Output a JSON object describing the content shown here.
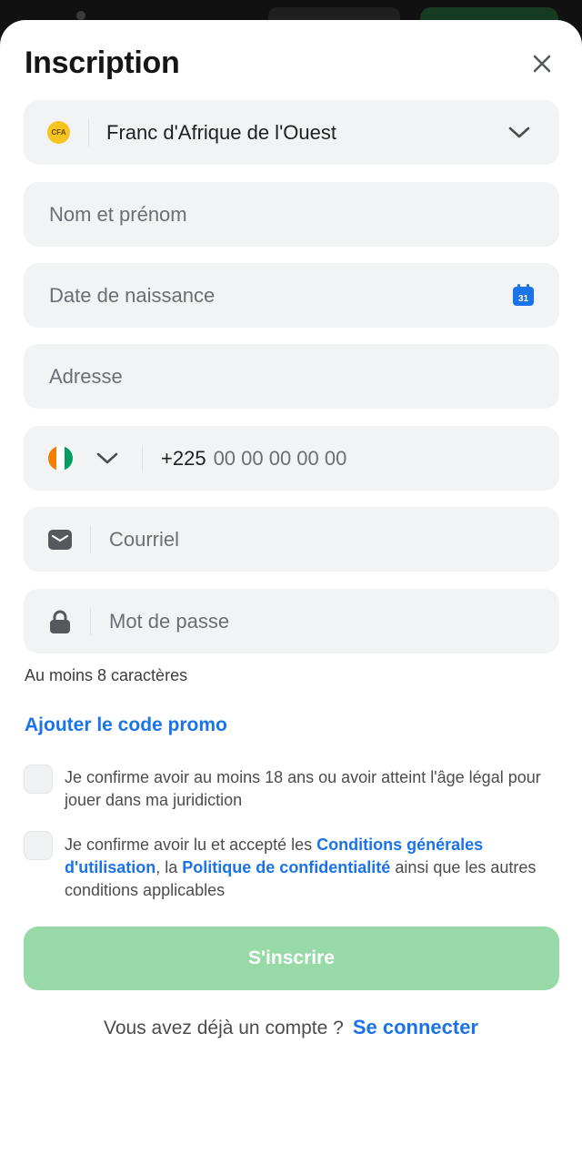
{
  "form": {
    "title": "Inscription",
    "currency": {
      "badge": "CFA",
      "label": "Franc d'Afrique de l'Ouest"
    },
    "name_placeholder": "Nom et prénom",
    "birthdate_placeholder": "Date de naissance",
    "calendar_day": "31",
    "address_placeholder": "Adresse",
    "phone": {
      "prefix": "+225",
      "placeholder": "00 00 00 00 00",
      "flag_colors": [
        "#f77f00",
        "#ffffff",
        "#009e60"
      ]
    },
    "email_placeholder": "Courriel",
    "password_placeholder": "Mot de passe",
    "password_hint": "Au moins 8 caractères",
    "promo_link": "Ajouter le code promo",
    "age_consent": "Je confirme avoir au moins 18 ans ou avoir atteint l'âge légal pour jouer dans ma juridiction",
    "terms_consent": {
      "part1": "Je confirme avoir lu et accepté les ",
      "link1": "Conditions générales d'utilisation",
      "part2": ", la ",
      "link2": "Politique de confidentialité",
      "part3": " ainsi que les autres conditions applicables"
    },
    "submit_label": "S'inscrire",
    "login_prompt": "Vous avez déjà un compte ?",
    "login_link": "Se connecter"
  },
  "colors": {
    "accent": "#1a73e8",
    "submit_disabled": "#98d9a8",
    "field_bg": "#f2f3f5"
  }
}
